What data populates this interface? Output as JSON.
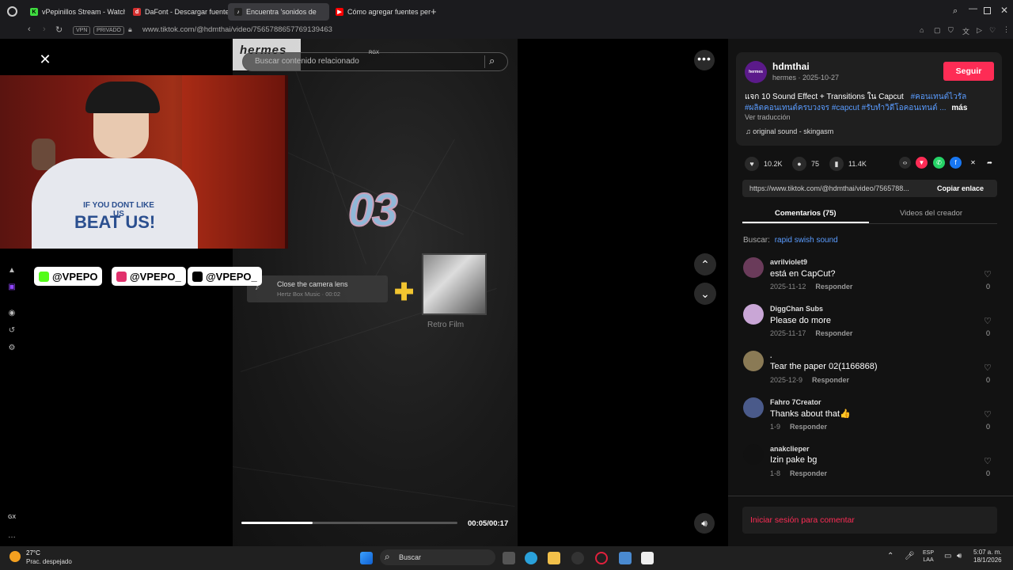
{
  "browser": {
    "tabs": [
      {
        "label": "vPepinillos Stream - Watch",
        "color": "#3fdc3f",
        "glyph": "K"
      },
      {
        "label": "DaFont - Descargar fuentes",
        "color": "#d32f2f",
        "glyph": "d"
      },
      {
        "label": "Encuentra 'sonidos de",
        "color": "#222222",
        "glyph": "♪"
      },
      {
        "label": "Cómo agregar fuentes per",
        "color": "#ff0000",
        "glyph": "▶"
      }
    ],
    "new_tab": "+",
    "vpn_label": "VPN",
    "private_label": "PRIVADO",
    "url": "www.tiktok.com/@hdmthai/video/7565788657769139463"
  },
  "video": {
    "overlay_brand": "hermes",
    "overlay_tag": "RGX",
    "search_placeholder": "Buscar contenido relacionado",
    "big_number": "03",
    "sound_title": "Close the camera lens",
    "sound_sub": "Hertz Box Music · 00:02",
    "film_label": "Retro Film",
    "time": "00:05/00:17",
    "progress": 0.33
  },
  "webcam": {
    "shirt_line1": "IF YOU DONT LIKE US",
    "shirt_line2": "BEAT US!"
  },
  "socials": [
    {
      "handle": "@VPEPO",
      "color": "#53fc18"
    },
    {
      "handle": "@VPEPO_",
      "color": "#e1306c"
    },
    {
      "handle": "@VPEPO_",
      "color": "#000000"
    }
  ],
  "panel": {
    "avatar_text": "hermes",
    "username": "hdmthai",
    "user_meta": "hermes · 2025-10-27",
    "follow": "Seguir",
    "caption_line1_text": "แจก 10 Sound Effect + Transitions ใน Capcut",
    "caption_line1_hash": "#คอนเทนต์ไวรัล",
    "caption_line2_hash": "#ผลิตคอนเทนต์ครบวงจร #capcut #รับทำวิดีโอคอนเทนต์ ...",
    "caption_more": "más",
    "translate": "Ver traducción",
    "music": "♫  original sound - skingasm",
    "likes": "10.2K",
    "comments_count": "75",
    "saves": "11.4K",
    "link": "https://www.tiktok.com/@hdmthai/video/7565788...",
    "copy_link": "Copiar enlace",
    "tab_comments": "Comentarios (75)",
    "tab_creator": "Videos del creador",
    "search_prefix": "Buscar:",
    "search_term": "rapid swish sound",
    "login": "Iniciar sesión para comentar"
  },
  "comments": [
    {
      "user": "avrilviolet9",
      "text": "está en CapCut?",
      "date": "2025-11-12",
      "reply": "Responder",
      "likes": "0",
      "color": "#6a3b5a"
    },
    {
      "user": "DiggChan Subs",
      "text": "Please do more",
      "date": "2025-11-17",
      "reply": "Responder",
      "likes": "0",
      "color": "#c9a6d6"
    },
    {
      "user": ".",
      "text": "Tear the paper 02(1166868)",
      "date": "2025-12-9",
      "reply": "Responder",
      "likes": "0",
      "color": "#8a7a55"
    },
    {
      "user": "Fahro 7Creator",
      "text": "Thanks about that👍",
      "date": "1-9",
      "reply": "Responder",
      "likes": "0",
      "color": "#4a5a8a"
    },
    {
      "user": "anakclieper",
      "text": "Izin pake bg",
      "date": "1-8",
      "reply": "Responder",
      "likes": "0",
      "color": "#111111"
    }
  ],
  "taskbar": {
    "temp": "27°C",
    "weather": "Prac. despejado",
    "search": "Buscar",
    "lang": "ESP\nLAA",
    "time": "5:07 a. m.",
    "date": "18/1/2026"
  }
}
